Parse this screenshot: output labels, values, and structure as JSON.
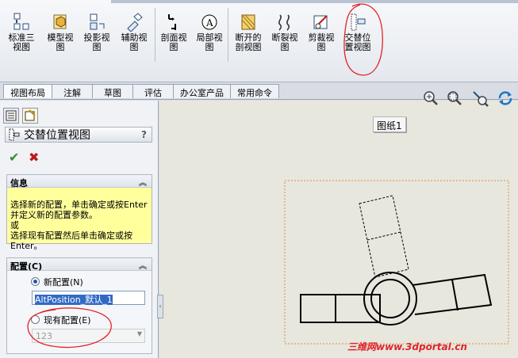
{
  "ribbon": {
    "tools": [
      {
        "label": "标准三\n视图",
        "icon": "standard-3-view-icon"
      },
      {
        "label": "模型视\n图",
        "icon": "model-view-icon"
      },
      {
        "label": "投影视\n图",
        "icon": "projected-view-icon"
      },
      {
        "label": "辅助视\n图",
        "icon": "auxiliary-view-icon"
      },
      {
        "label": "剖面视\n图",
        "icon": "section-view-icon"
      },
      {
        "label": "局部视\n图",
        "icon": "detail-view-icon"
      },
      {
        "label": "断开的\n剖视图",
        "icon": "broken-out-section-icon"
      },
      {
        "label": "断裂视\n图",
        "icon": "break-view-icon"
      },
      {
        "label": "剪裁视\n图",
        "icon": "crop-view-icon"
      },
      {
        "label": "交替位\n置视图",
        "icon": "alternate-position-view-icon"
      }
    ]
  },
  "tabs": [
    "视图布局",
    "注解",
    "草图",
    "评估",
    "办公室产品",
    "常用命令"
  ],
  "panel": {
    "title": "交替位置视图",
    "help": "?",
    "info": {
      "header": "信息",
      "text": "选择新的配置，单击确定或按Enter 并定义新的配置参数。\n或\n选择现有配置然后单击确定或按Enter。"
    },
    "config": {
      "header": "配置(C)",
      "new_label": "新配置(N)",
      "new_value": "AltPosition_默认_1",
      "existing_label": "现有配置(E)",
      "existing_value": "123"
    }
  },
  "graphics": {
    "sheet_tooltip": "图纸1",
    "watermark": "三维网www.3dportal.cn"
  },
  "colors": {
    "annotation": "#e0242a",
    "info_bg": "#ffff9c",
    "graphics_bg": "#e7e7de"
  }
}
